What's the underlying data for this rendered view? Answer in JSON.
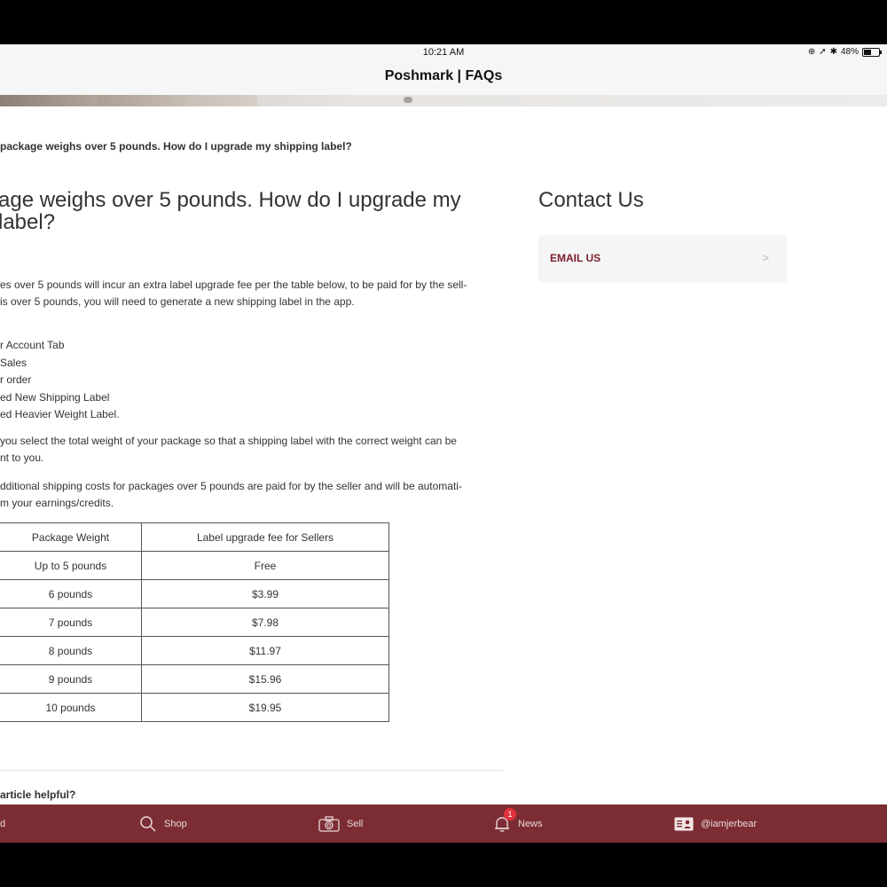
{
  "status": {
    "time": "10:21 AM",
    "battery": "48%"
  },
  "nav": {
    "title": "Poshmark | FAQs"
  },
  "article": {
    "breadcrumb": "package weighs over 5 pounds. How do I upgrade my shipping label?",
    "title_line1": "age weighs over 5 pounds. How do I upgrade my",
    "title_line2": "label?",
    "intro_line1": "es over 5 pounds will incur an extra label upgrade fee per the table below, to be paid for by the sell-",
    "intro_line2": " is over 5 pounds, you will need to generate a new shipping label in the app.",
    "steps": [
      "r Account Tab",
      " Sales",
      "r order",
      "ed New Shipping Label",
      "ed Heavier Weight Label."
    ],
    "select_line1": "you select the total weight of your package so that a shipping label with the correct weight can be",
    "select_line2": "nt to you.",
    "costs_line1": "dditional shipping costs for packages over 5 pounds are paid for by the seller and will be automati-",
    "costs_line2": "m your earnings/credits.",
    "table": {
      "headers": [
        "Package Weight",
        "Label upgrade fee for Sellers"
      ],
      "rows": [
        [
          "Up to 5 pounds",
          "Free"
        ],
        [
          "6 pounds",
          "$3.99"
        ],
        [
          "7 pounds",
          "$7.98"
        ],
        [
          "8 pounds",
          "$11.97"
        ],
        [
          "9 pounds",
          "$15.96"
        ],
        [
          "10 pounds",
          "$19.95"
        ]
      ]
    },
    "helpful": "article helpful?"
  },
  "contact": {
    "title": "Contact Us",
    "email_label": "EMAIL US"
  },
  "tabbar": {
    "items": [
      {
        "label": "d",
        "icon": "home-icon"
      },
      {
        "label": "Shop",
        "icon": "search-icon"
      },
      {
        "label": "Sell",
        "icon": "camera-icon"
      },
      {
        "label": "News",
        "icon": "bell-icon",
        "badge": "1"
      },
      {
        "label": "@iamjerbear",
        "icon": "profile-card-icon"
      }
    ]
  },
  "colors": {
    "accent": "#7c2d34",
    "link": "#7b1f2b",
    "badge": "#e2303a"
  }
}
